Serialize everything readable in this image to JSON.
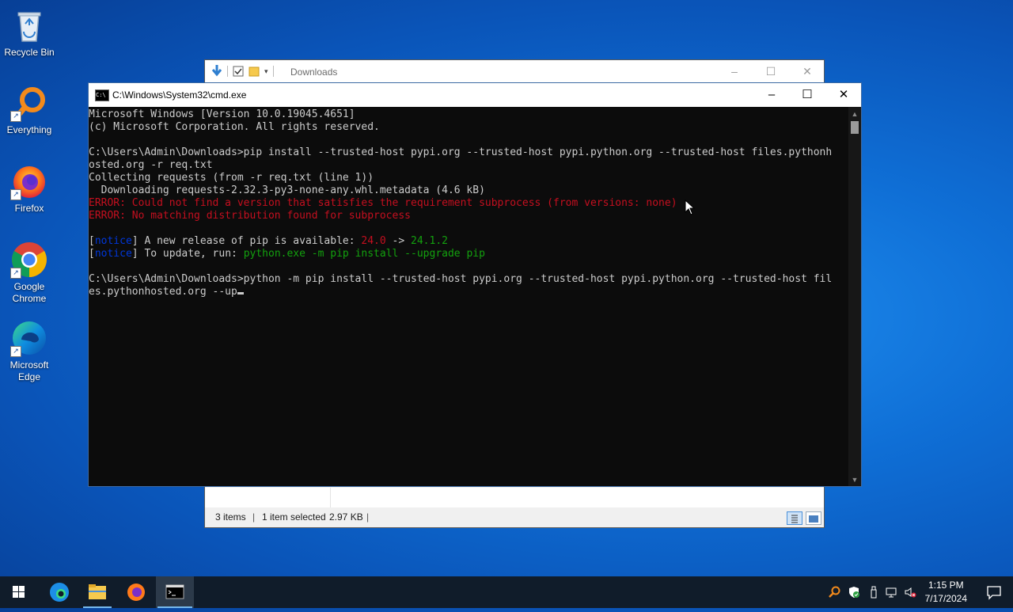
{
  "desktop": {
    "icons": [
      {
        "label": "Recycle Bin",
        "icon": "recycle-bin-icon"
      },
      {
        "label": "Everything",
        "icon": "search-magnifier-icon"
      },
      {
        "label": "Firefox",
        "icon": "firefox-icon"
      },
      {
        "label": "Google Chrome",
        "icon": "chrome-icon"
      },
      {
        "label": "Microsoft Edge",
        "icon": "edge-icon"
      }
    ]
  },
  "explorer": {
    "title": "Downloads",
    "status": {
      "items": "3 items",
      "selected": "1 item selected",
      "size": "2.97 KB"
    }
  },
  "cmd": {
    "title": "C:\\Windows\\System32\\cmd.exe",
    "icon_text": "C:\\",
    "lines": [
      [
        {
          "t": "Microsoft Windows [Version 10.0.19045.4651]"
        }
      ],
      [
        {
          "t": "(c) Microsoft Corporation. All rights reserved."
        }
      ],
      [
        {
          "t": ""
        }
      ],
      [
        {
          "t": "C:\\Users\\Admin\\Downloads>pip install --trusted-host pypi.org --trusted-host pypi.python.org --trusted-host files.pythonh"
        }
      ],
      [
        {
          "t": "osted.org -r req.txt"
        }
      ],
      [
        {
          "t": "Collecting requests (from -r req.txt (line 1))"
        }
      ],
      [
        {
          "t": "  Downloading requests-2.32.3-py3-none-any.whl.metadata (4.6 kB)"
        }
      ],
      [
        {
          "t": "ERROR: Could not find a version that satisfies the requirement subprocess (from versions: none)",
          "c": "err"
        }
      ],
      [
        {
          "t": "ERROR: No matching distribution found for subprocess",
          "c": "err"
        }
      ],
      [
        {
          "t": ""
        }
      ],
      [
        {
          "t": "["
        },
        {
          "t": "notice",
          "c": "blue"
        },
        {
          "t": "] A new release of pip is available: "
        },
        {
          "t": "24.0",
          "c": "red"
        },
        {
          "t": " -> "
        },
        {
          "t": "24.1.2",
          "c": "green"
        }
      ],
      [
        {
          "t": "["
        },
        {
          "t": "notice",
          "c": "blue"
        },
        {
          "t": "] To update, run: "
        },
        {
          "t": "python.exe -m pip install --upgrade pip",
          "c": "green"
        }
      ],
      [
        {
          "t": ""
        }
      ],
      [
        {
          "t": "C:\\Users\\Admin\\Downloads>python -m pip install --trusted-host pypi.org --trusted-host pypi.python.org --trusted-host fil"
        }
      ],
      [
        {
          "t": "es.pythonhosted.org --up"
        },
        {
          "cursor": true
        }
      ]
    ]
  },
  "taskbar": {
    "apps": [
      "start-icon",
      "edge-icon",
      "file-explorer-icon",
      "firefox-icon",
      "cmd-icon"
    ],
    "tray": [
      "everything-icon",
      "security-shield-icon",
      "usb-device-icon",
      "network-icon",
      "volume-muted-icon"
    ],
    "time": "1:15 PM",
    "date": "7/17/2024"
  }
}
